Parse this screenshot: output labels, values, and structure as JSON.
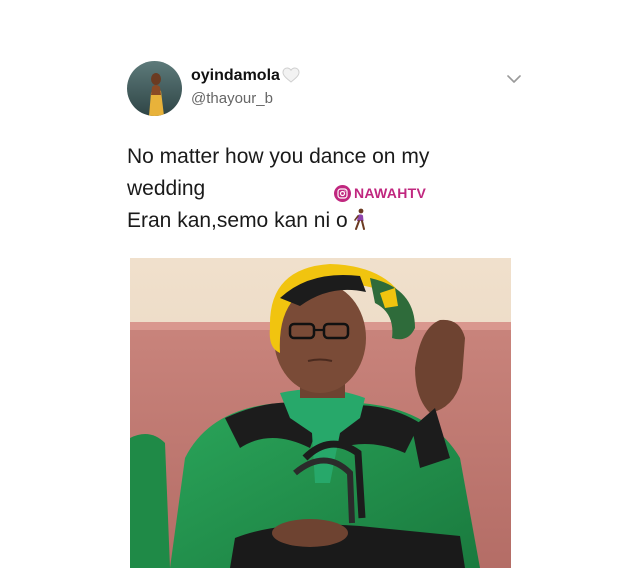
{
  "tweet": {
    "display_name": "oyindamola",
    "handle": "@thayour_b",
    "text": "No matter how you dance on my\nwedding\nEran kan,semo kan ni o",
    "trailing_emoji": "walking-woman-emoji"
  },
  "watermark": {
    "label": "NAWAHTV",
    "color": "#c0277f"
  },
  "icons": {
    "verified": "white-heart-icon",
    "menu": "chevron-down-icon",
    "instagram": "instagram-icon"
  },
  "colors": {
    "background": "#ffffff",
    "handle": "#666666",
    "text": "#1a1a1a"
  }
}
